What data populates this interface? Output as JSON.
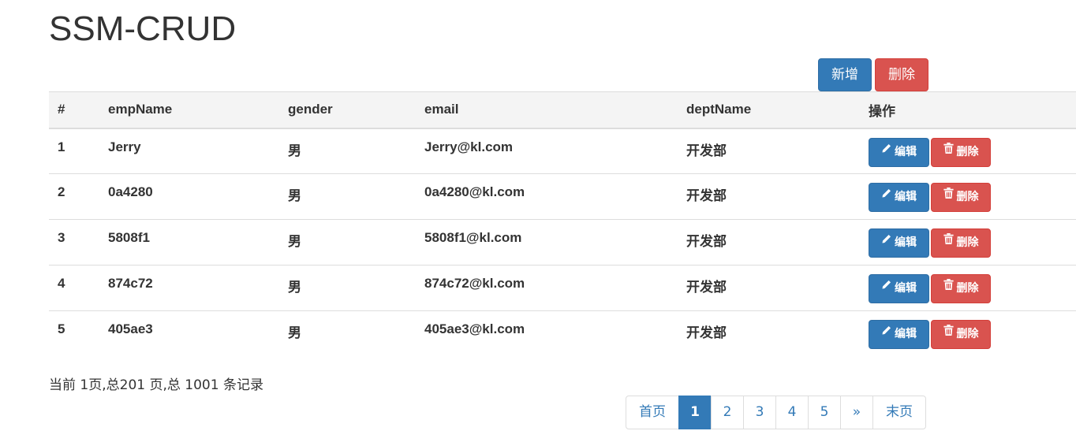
{
  "app": {
    "title": "SSM-CRUD"
  },
  "toolbar": {
    "add_label": "新增",
    "delete_label": "删除"
  },
  "table": {
    "headers": [
      "#",
      "empName",
      "gender",
      "email",
      "deptName",
      "操作"
    ],
    "rows": [
      {
        "id": "1",
        "empName": "Jerry",
        "gender": "男",
        "email": "Jerry@kl.com",
        "deptName": "开发部"
      },
      {
        "id": "2",
        "empName": "0a4280",
        "gender": "男",
        "email": "0a4280@kl.com",
        "deptName": "开发部"
      },
      {
        "id": "3",
        "empName": "5808f1",
        "gender": "男",
        "email": "5808f1@kl.com",
        "deptName": "开发部"
      },
      {
        "id": "4",
        "empName": "874c72",
        "gender": "男",
        "email": "874c72@kl.com",
        "deptName": "开发部"
      },
      {
        "id": "5",
        "empName": "405ae3",
        "gender": "男",
        "email": "405ae3@kl.com",
        "deptName": "开发部"
      }
    ],
    "row_actions": {
      "edit_label": "编辑",
      "edit_icon": "pencil-icon",
      "delete_label": "删除",
      "delete_icon": "trash-icon"
    }
  },
  "page_info": "当前 1页,总201 页,总 1001 条记录",
  "pagination": {
    "first_label": "首页",
    "pages": [
      "1",
      "2",
      "3",
      "4",
      "5"
    ],
    "current": "1",
    "next_label": "»",
    "last_label": "末页"
  },
  "colors": {
    "primary": "#337ab7",
    "danger": "#d9534f",
    "header_bg": "#f4f4f4"
  }
}
